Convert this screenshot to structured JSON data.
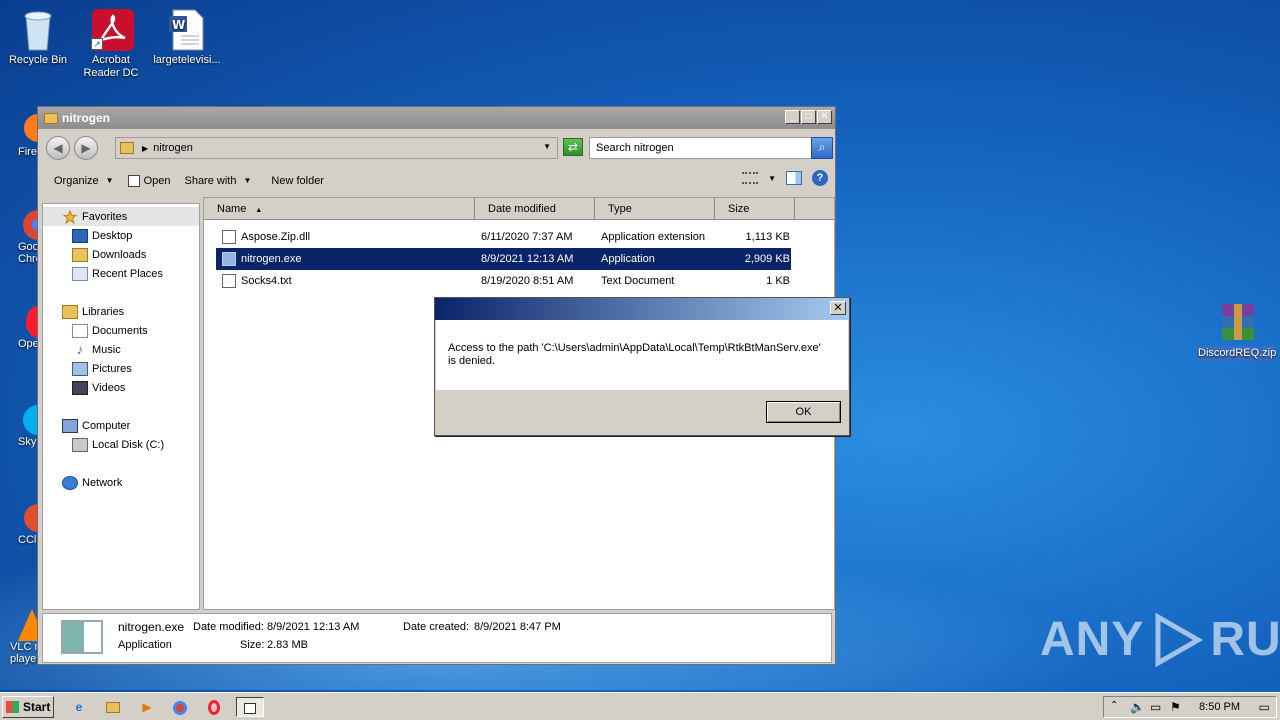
{
  "desktop": {
    "icons": [
      {
        "label": "Recycle Bin"
      },
      {
        "label": "Acrobat Reader DC"
      },
      {
        "label": "largetelevisi..."
      },
      {
        "label": "DiscordREQ.zip"
      }
    ],
    "side_labels": [
      "Fire",
      "Goo Chro",
      "Ope",
      "Sky",
      "CCle",
      "VLC m player"
    ]
  },
  "explorer": {
    "title": "nitrogen",
    "address": "nitrogen",
    "search_placeholder": "Search nitrogen",
    "toolbar": {
      "organize": "Organize",
      "open": "Open",
      "share_with": "Share with",
      "new_folder": "New folder"
    },
    "nav": {
      "favorites": "Favorites",
      "desktop": "Desktop",
      "downloads": "Downloads",
      "recent": "Recent Places",
      "libraries": "Libraries",
      "documents": "Documents",
      "music": "Music",
      "pictures": "Pictures",
      "videos": "Videos",
      "computer": "Computer",
      "local_disk": "Local Disk (C:)",
      "network": "Network"
    },
    "columns": [
      "Name",
      "Date modified",
      "Type",
      "Size"
    ],
    "files": [
      {
        "name": "Aspose.Zip.dll",
        "date": "6/11/2020 7:37 AM",
        "type": "Application extension",
        "size": "1,113 KB"
      },
      {
        "name": "nitrogen.exe",
        "date": "8/9/2021 12:13 AM",
        "type": "Application",
        "size": "2,909 KB"
      },
      {
        "name": "Socks4.txt",
        "date": "8/19/2020 8:51 AM",
        "type": "Text Document",
        "size": "1 KB"
      }
    ],
    "details": {
      "name": "nitrogen.exe",
      "type": "Application",
      "modified_label": "Date modified:",
      "modified": "8/9/2021 12:13 AM",
      "created_label": "Date created:",
      "created": "8/9/2021 8:47 PM",
      "size_label": "Size:",
      "size": "2.83 MB"
    }
  },
  "dialog": {
    "message_line1": "Access to the path 'C:\\Users\\admin\\AppData\\Local\\Temp\\RtkBtManServ.exe'",
    "message_line2": "is denied.",
    "ok": "OK"
  },
  "taskbar": {
    "start": "Start",
    "clock": "8:50 PM"
  },
  "watermark": {
    "left": "ANY",
    "right": "RUN"
  }
}
